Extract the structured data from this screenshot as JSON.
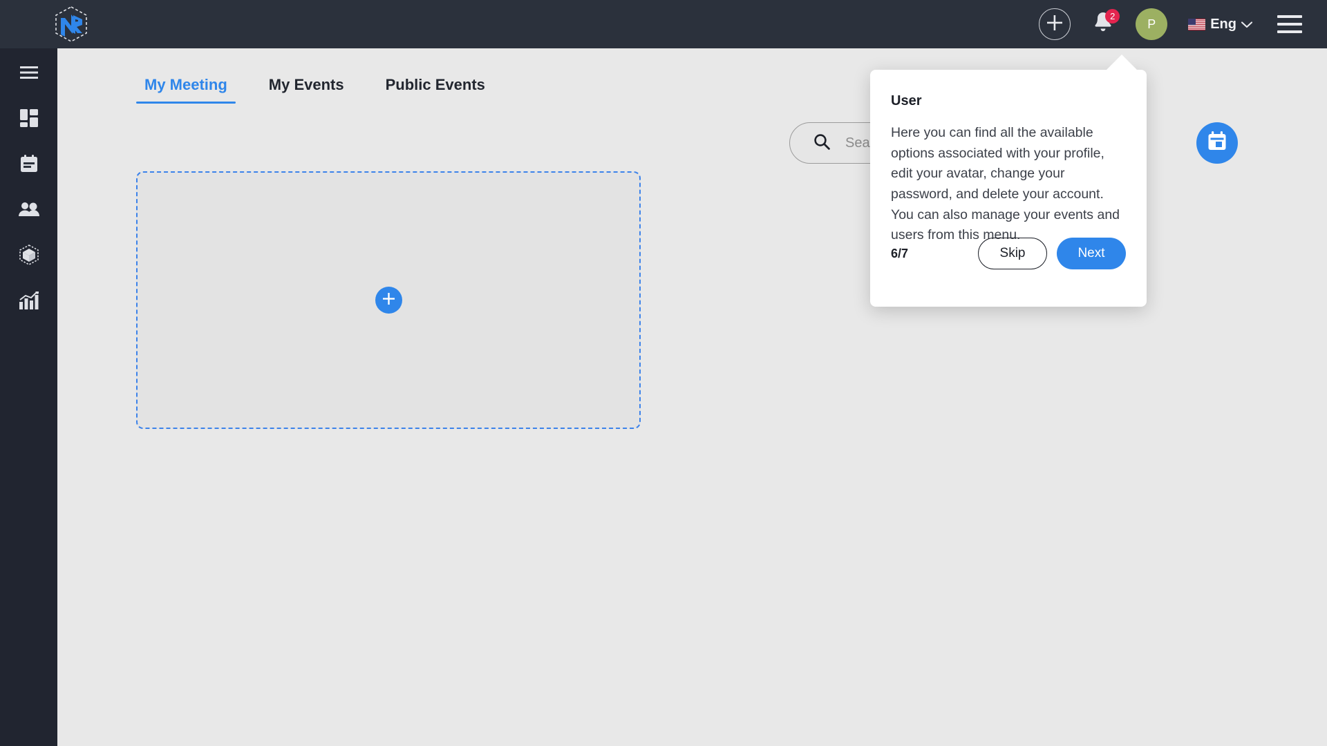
{
  "theme": {
    "sidebar_bg": "#212530",
    "topbar_bg": "#2b313c",
    "page_bg": "#e8e8e8",
    "accent": "#2f86ea",
    "badge_bg": "#e4244f",
    "avatar_bg": "#9cb062"
  },
  "topbar": {
    "logo_text": "NR",
    "add_icon": "plus-icon",
    "notifications_icon": "bell-icon",
    "notifications_count": "2",
    "avatar_initial": "P",
    "language_label": "Eng",
    "language_flag": "us-flag-icon",
    "language_chevron": "chevron-down-icon",
    "menu_icon": "hamburger-icon"
  },
  "sidebar": {
    "items": [
      {
        "icon": "hamburger-icon",
        "name": "menu-toggle"
      },
      {
        "icon": "dashboard-grid-icon",
        "name": "dashboard"
      },
      {
        "icon": "calendar-icon",
        "name": "calendar"
      },
      {
        "icon": "users-icon",
        "name": "users"
      },
      {
        "icon": "cube-icon",
        "name": "products"
      },
      {
        "icon": "analytics-bar-chart-icon",
        "name": "analytics"
      }
    ]
  },
  "main": {
    "tabs": [
      {
        "label": "My Meeting",
        "active": true
      },
      {
        "label": "My Events",
        "active": false
      },
      {
        "label": "Public Events",
        "active": false
      }
    ],
    "search": {
      "placeholder": "Search...",
      "value": "",
      "icon": "search-icon"
    },
    "calendar_button_icon": "calendar-icon",
    "dropzone": {
      "add_icon": "plus-icon"
    }
  },
  "tour": {
    "title": "User",
    "body": "Here you can find all the available options associated with your profile, edit your avatar, change your password, and delete your account. You can also manage your events and users from this menu.",
    "step": "6/7",
    "skip_label": "Skip",
    "next_label": "Next"
  }
}
